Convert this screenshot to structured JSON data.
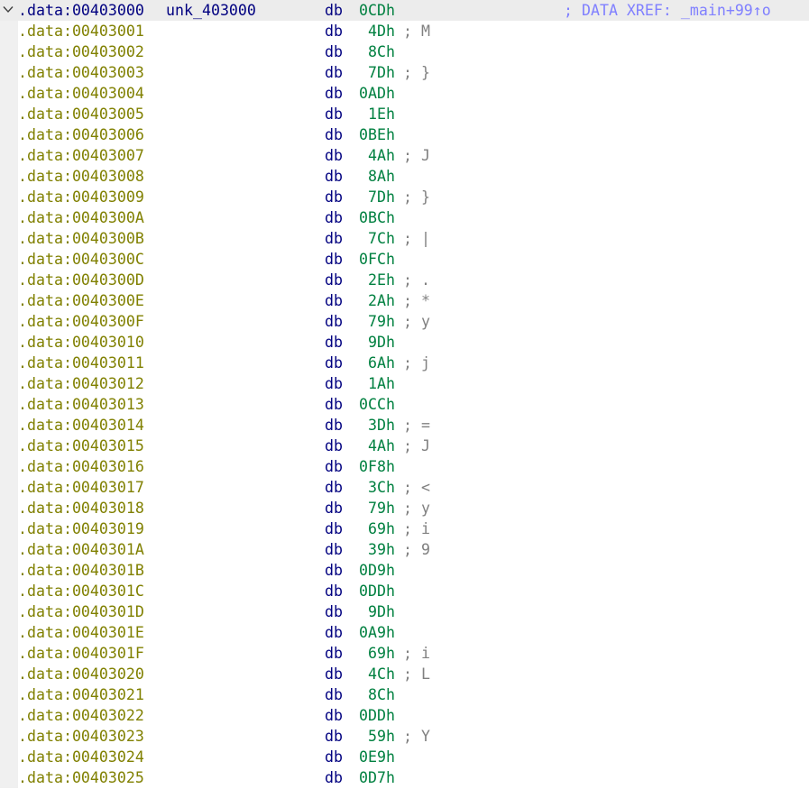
{
  "header": {
    "address": ".data:00403000",
    "label": "unk_403000",
    "mnemonic": "db",
    "value": "0CDh",
    "xref": "; DATA XREF: _main+99↑o",
    "fold_icon": "chevron-down-icon"
  },
  "rows": [
    {
      "address": ".data:00403001",
      "mnemonic": "db",
      "value": "4Dh",
      "comment": "; M"
    },
    {
      "address": ".data:00403002",
      "mnemonic": "db",
      "value": "8Ch",
      "comment": ""
    },
    {
      "address": ".data:00403003",
      "mnemonic": "db",
      "value": "7Dh",
      "comment": "; }"
    },
    {
      "address": ".data:00403004",
      "mnemonic": "db",
      "value": "0ADh",
      "comment": ""
    },
    {
      "address": ".data:00403005",
      "mnemonic": "db",
      "value": "1Eh",
      "comment": ""
    },
    {
      "address": ".data:00403006",
      "mnemonic": "db",
      "value": "0BEh",
      "comment": ""
    },
    {
      "address": ".data:00403007",
      "mnemonic": "db",
      "value": "4Ah",
      "comment": "; J"
    },
    {
      "address": ".data:00403008",
      "mnemonic": "db",
      "value": "8Ah",
      "comment": ""
    },
    {
      "address": ".data:00403009",
      "mnemonic": "db",
      "value": "7Dh",
      "comment": "; }"
    },
    {
      "address": ".data:0040300A",
      "mnemonic": "db",
      "value": "0BCh",
      "comment": ""
    },
    {
      "address": ".data:0040300B",
      "mnemonic": "db",
      "value": "7Ch",
      "comment": "; |"
    },
    {
      "address": ".data:0040300C",
      "mnemonic": "db",
      "value": "0FCh",
      "comment": ""
    },
    {
      "address": ".data:0040300D",
      "mnemonic": "db",
      "value": "2Eh",
      "comment": "; ."
    },
    {
      "address": ".data:0040300E",
      "mnemonic": "db",
      "value": "2Ah",
      "comment": "; *"
    },
    {
      "address": ".data:0040300F",
      "mnemonic": "db",
      "value": "79h",
      "comment": "; y"
    },
    {
      "address": ".data:00403010",
      "mnemonic": "db",
      "value": "9Dh",
      "comment": ""
    },
    {
      "address": ".data:00403011",
      "mnemonic": "db",
      "value": "6Ah",
      "comment": "; j"
    },
    {
      "address": ".data:00403012",
      "mnemonic": "db",
      "value": "1Ah",
      "comment": ""
    },
    {
      "address": ".data:00403013",
      "mnemonic": "db",
      "value": "0CCh",
      "comment": ""
    },
    {
      "address": ".data:00403014",
      "mnemonic": "db",
      "value": "3Dh",
      "comment": "; ="
    },
    {
      "address": ".data:00403015",
      "mnemonic": "db",
      "value": "4Ah",
      "comment": "; J"
    },
    {
      "address": ".data:00403016",
      "mnemonic": "db",
      "value": "0F8h",
      "comment": ""
    },
    {
      "address": ".data:00403017",
      "mnemonic": "db",
      "value": "3Ch",
      "comment": "; <"
    },
    {
      "address": ".data:00403018",
      "mnemonic": "db",
      "value": "79h",
      "comment": "; y"
    },
    {
      "address": ".data:00403019",
      "mnemonic": "db",
      "value": "69h",
      "comment": "; i"
    },
    {
      "address": ".data:0040301A",
      "mnemonic": "db",
      "value": "39h",
      "comment": "; 9"
    },
    {
      "address": ".data:0040301B",
      "mnemonic": "db",
      "value": "0D9h",
      "comment": ""
    },
    {
      "address": ".data:0040301C",
      "mnemonic": "db",
      "value": "0DDh",
      "comment": ""
    },
    {
      "address": ".data:0040301D",
      "mnemonic": "db",
      "value": "9Dh",
      "comment": ""
    },
    {
      "address": ".data:0040301E",
      "mnemonic": "db",
      "value": "0A9h",
      "comment": ""
    },
    {
      "address": ".data:0040301F",
      "mnemonic": "db",
      "value": "69h",
      "comment": "; i"
    },
    {
      "address": ".data:00403020",
      "mnemonic": "db",
      "value": "4Ch",
      "comment": "; L"
    },
    {
      "address": ".data:00403021",
      "mnemonic": "db",
      "value": "8Ch",
      "comment": ""
    },
    {
      "address": ".data:00403022",
      "mnemonic": "db",
      "value": "0DDh",
      "comment": ""
    },
    {
      "address": ".data:00403023",
      "mnemonic": "db",
      "value": "59h",
      "comment": "; Y"
    },
    {
      "address": ".data:00403024",
      "mnemonic": "db",
      "value": "0E9h",
      "comment": ""
    },
    {
      "address": ".data:00403025",
      "mnemonic": "db",
      "value": "0D7h",
      "comment": ""
    }
  ],
  "colors": {
    "address": "#808000",
    "header_address": "#000080",
    "mnemonic": "#000080",
    "value": "#008040",
    "comment": "#808080",
    "xref": "#8080ff",
    "header_background": "#ececec"
  }
}
